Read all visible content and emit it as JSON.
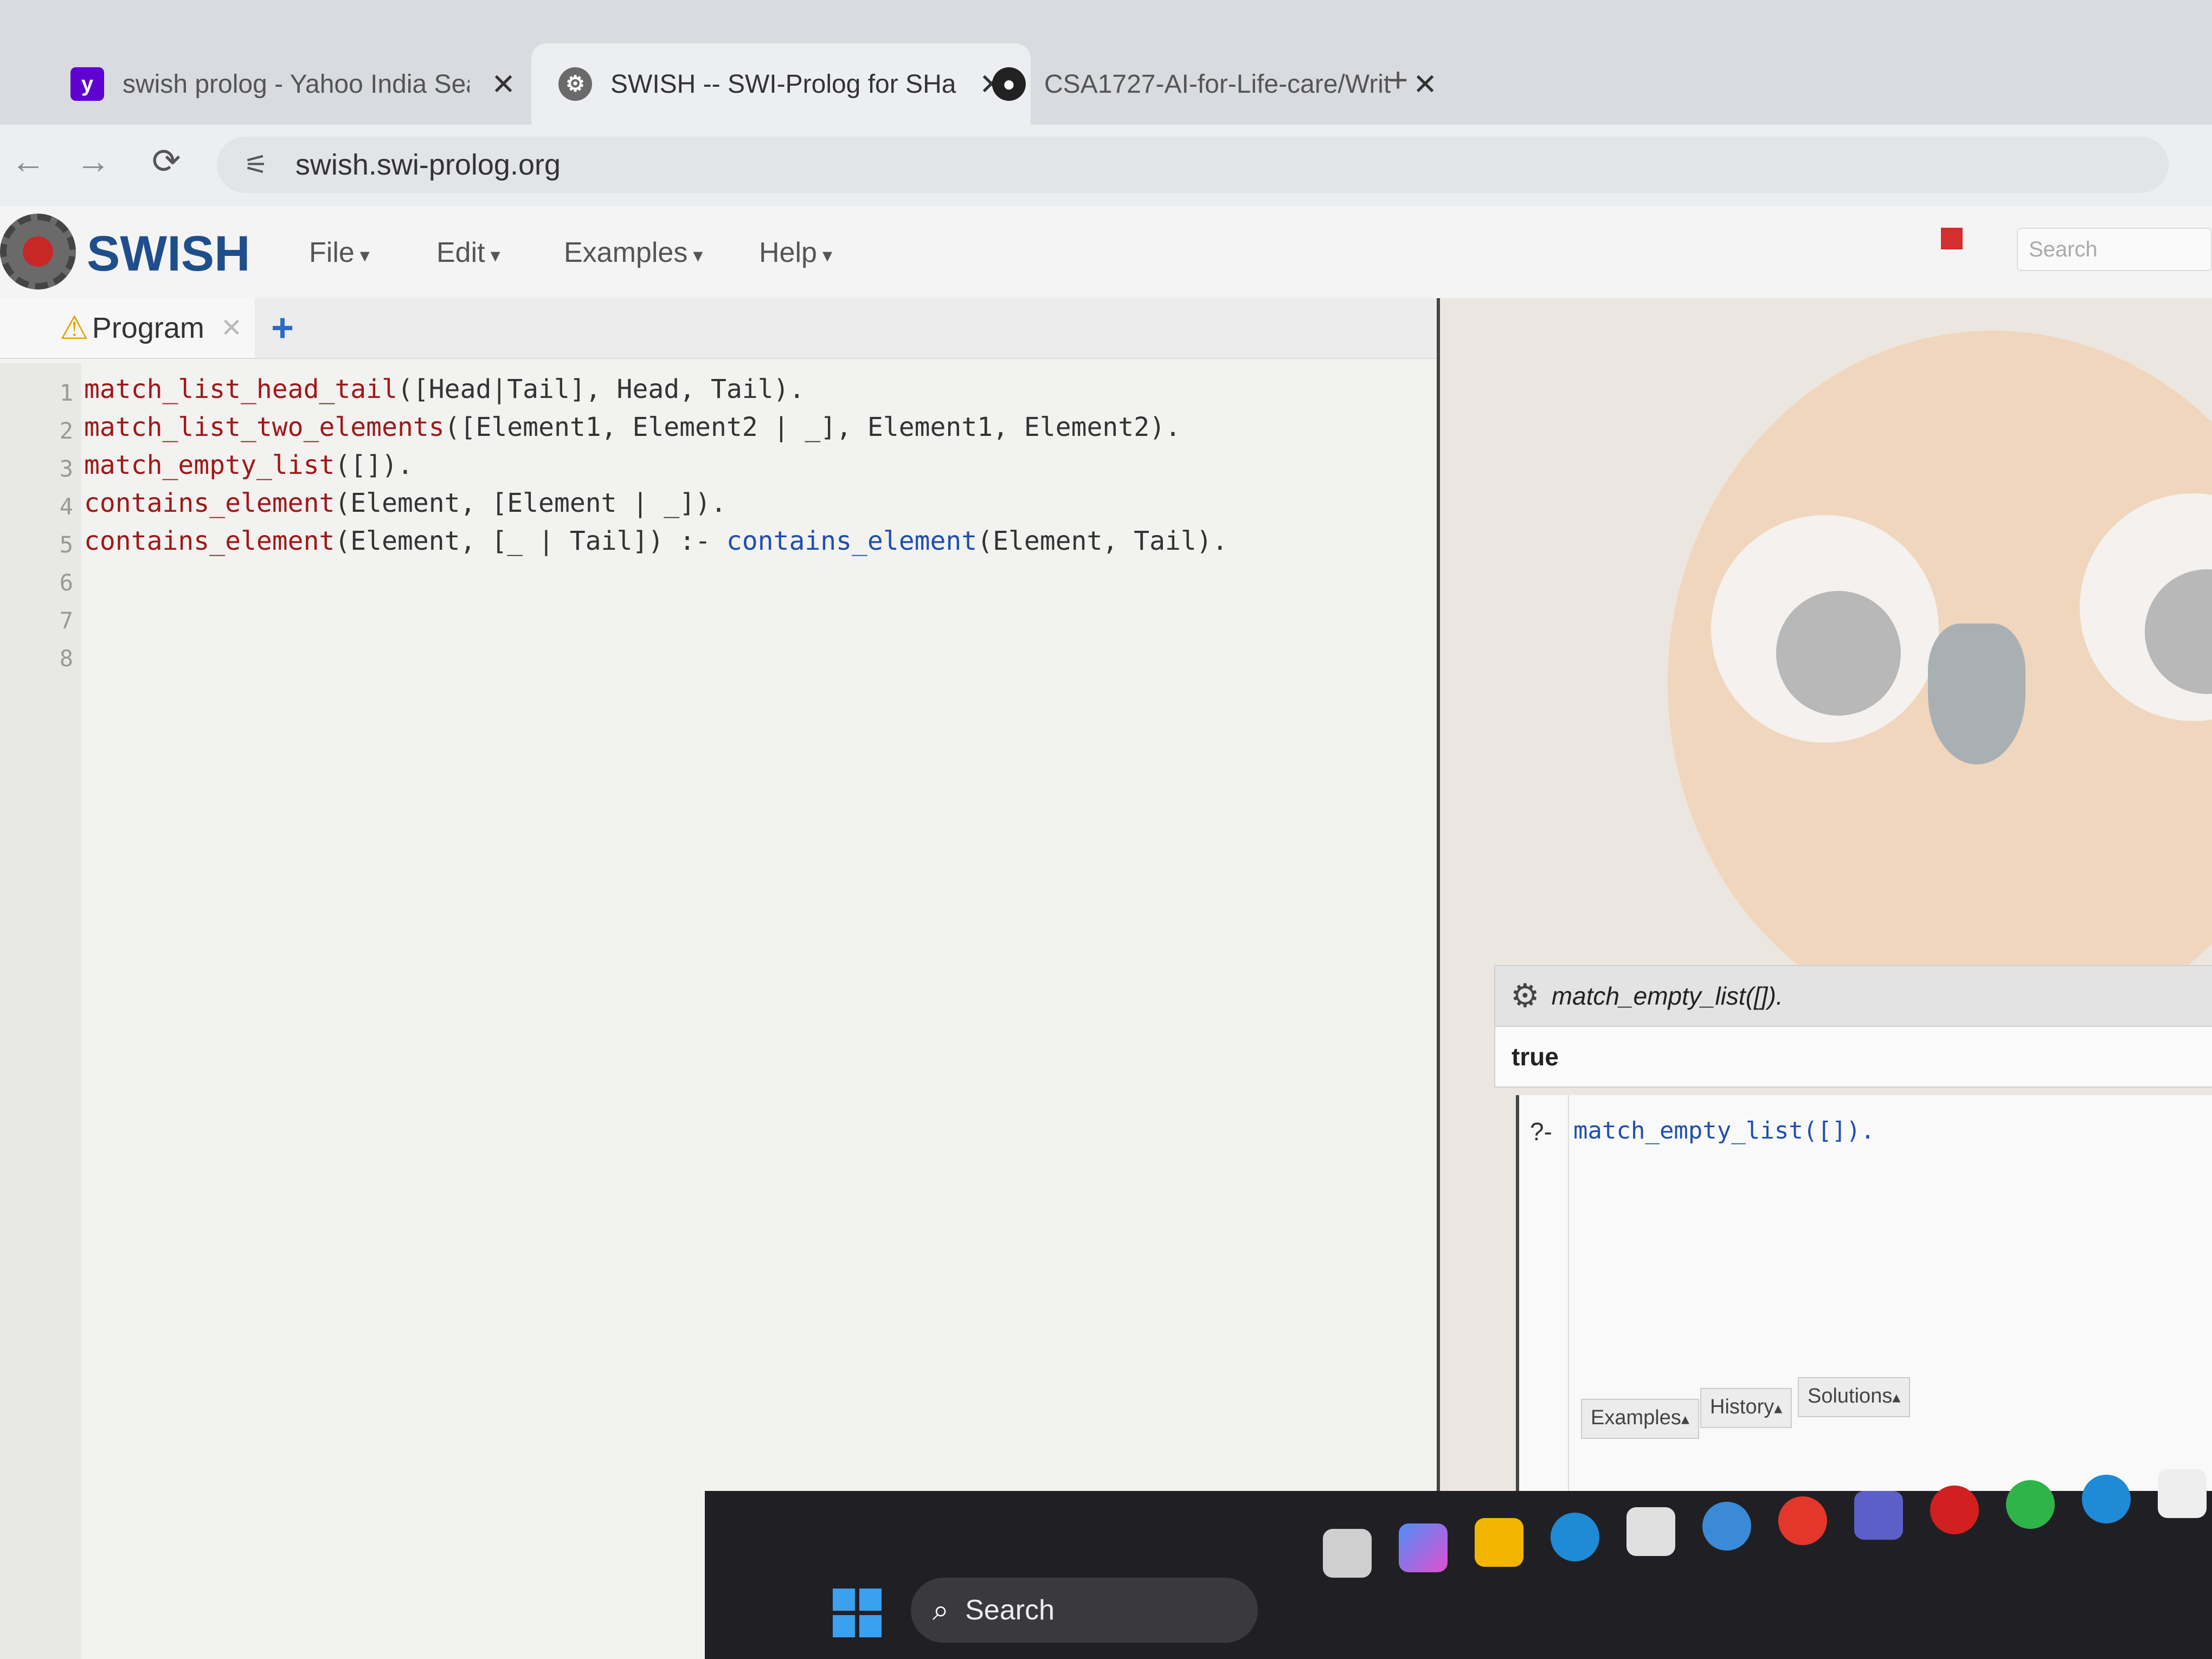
{
  "browser": {
    "tabs": [
      {
        "title": "swish prolog - Yahoo India Sea",
        "close": "✕",
        "favicon": "yahoo-icon",
        "active": false
      },
      {
        "title": "SWISH -- SWI-Prolog for SHari",
        "close": "✕",
        "favicon": "swish-gear-icon",
        "active": true
      },
      {
        "title": "CSA1727-AI-for-Life-care/Writ",
        "close": "✕",
        "favicon": "github-icon",
        "active": false
      }
    ],
    "new_tab": "+",
    "nav": {
      "back": "←",
      "forward": "→",
      "reload": "⟳"
    },
    "url": "swish.swi-prolog.org"
  },
  "swish": {
    "brand": "SWISH",
    "menus": [
      "File",
      "Edit",
      "Examples",
      "Help"
    ],
    "search_placeholder": "Search"
  },
  "editor": {
    "tab_label": "Program",
    "tab_close": "✕",
    "add_tab": "+",
    "line_numbers": [
      "1",
      "2",
      "3",
      "4",
      "5",
      "6",
      "7",
      "8"
    ],
    "code": [
      {
        "head": "match_list_head_tail",
        "rest": "([Head|Tail], Head, Tail).",
        "call": "",
        "tail": ""
      },
      {
        "head": "match_list_two_elements",
        "rest": "([Element1, Element2 | _], Element1, Element2).",
        "call": "",
        "tail": ""
      },
      {
        "head": "match_empty_list",
        "rest": "([]).",
        "call": "",
        "tail": ""
      },
      {
        "head": "contains_element",
        "rest": "(Element, [Element | _]).",
        "call": "",
        "tail": ""
      },
      {
        "head": "contains_element",
        "rest": "(Element, [_ | Tail]) :- ",
        "call": "contains_element",
        "tail": "(Element, Tail)."
      }
    ]
  },
  "results": {
    "query_echo": "match_empty_list([]).",
    "answer": "true",
    "prompt": "?-",
    "query_input": "match_empty_list([]).",
    "buttons": [
      "Examples",
      "History",
      "Solutions"
    ]
  },
  "taskbar": {
    "search_label": "Search"
  },
  "colors": {
    "brand": "#1f4e8c",
    "predicate": "#a01818",
    "call": "#1f4fb0"
  }
}
